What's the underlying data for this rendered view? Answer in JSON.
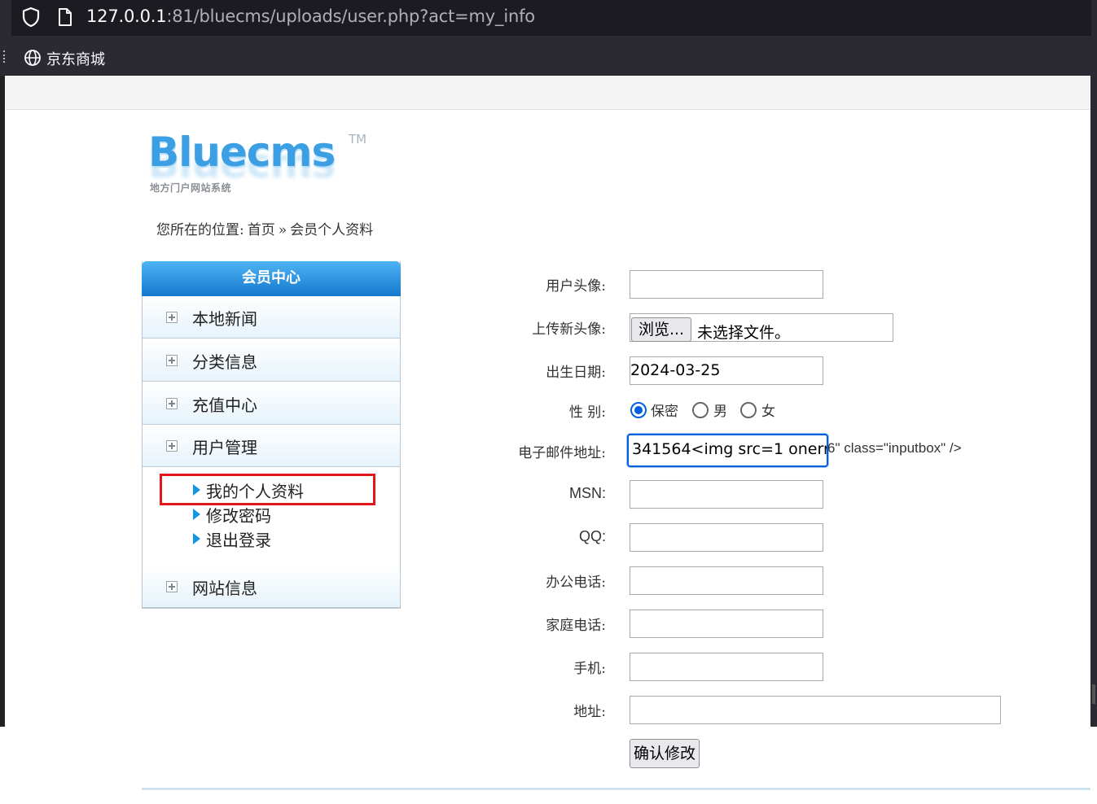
{
  "browser": {
    "url_host": "127.0.0.1",
    "url_rest": ":81/bluecms/uploads/user.php?act=my_info",
    "bookmark_label": "京东商城"
  },
  "logo": {
    "name": "Bluecms",
    "tm": "TM",
    "subtitle": "地方门户网站系统"
  },
  "breadcrumb": {
    "prefix": "您所在的位置:",
    "home": "首页",
    "sep": "»",
    "current": "会员个人资料"
  },
  "sidebar": {
    "title": "会员中心",
    "items": [
      {
        "label": "本地新闻"
      },
      {
        "label": "分类信息"
      },
      {
        "label": "充值中心"
      },
      {
        "label": "用户管理"
      },
      {
        "label": "网站信息"
      }
    ],
    "sub_items": [
      {
        "label": "我的个人资料"
      },
      {
        "label": "修改密码"
      },
      {
        "label": "退出登录"
      }
    ]
  },
  "form": {
    "avatar_label": "用户头像:",
    "upload_label": "上传新头像:",
    "browse_button": "浏览...",
    "no_file_text": "未选择文件。",
    "birthday_label": "出生日期:",
    "birthday_value": "2024-03-25",
    "gender_label": "性  别:",
    "gender_options": [
      "保密",
      "男",
      "女"
    ],
    "gender_selected": "保密",
    "email_label": "电子邮件地址:",
    "email_value": "341564<img src=1 onerro",
    "email_spill": "6\" class=\"inputbox\" />",
    "msn_label": "MSN:",
    "qq_label": "QQ:",
    "office_phone_label": "办公电话:",
    "home_phone_label": "家庭电话:",
    "mobile_label": "手机:",
    "address_label": "地址:",
    "submit_button": "确认修改"
  }
}
